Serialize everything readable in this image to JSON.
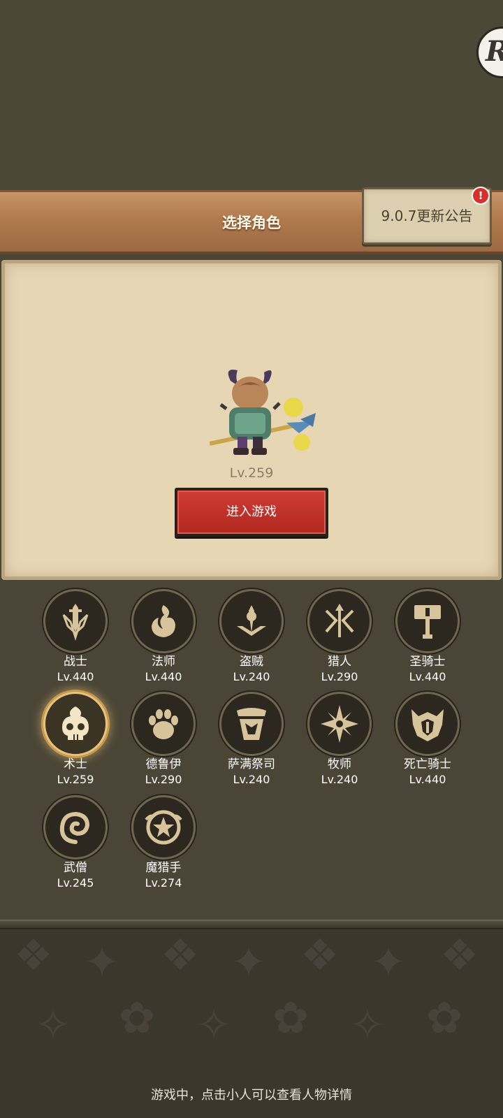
{
  "header": {
    "title": "选择角色",
    "notice_label": "9.0.7更新公告",
    "notice_badge": "!"
  },
  "corner_button_glyph": "R",
  "character": {
    "level": "Lv.259"
  },
  "enter_button_label": "进入游戏",
  "classes": [
    {
      "name": "战士",
      "level": "Lv.440",
      "icon": "sword-icon"
    },
    {
      "name": "法师",
      "level": "Lv.440",
      "icon": "flame-icon"
    },
    {
      "name": "盗贼",
      "level": "Lv.240",
      "icon": "dagger-icon"
    },
    {
      "name": "猎人",
      "level": "Lv.290",
      "icon": "arrows-icon"
    },
    {
      "name": "圣骑士",
      "level": "Lv.440",
      "icon": "hammer-icon"
    },
    {
      "name": "术士",
      "level": "Lv.259",
      "icon": "skull-icon",
      "selected": true
    },
    {
      "name": "德鲁伊",
      "level": "Lv.290",
      "icon": "paw-icon"
    },
    {
      "name": "萨满祭司",
      "level": "Lv.240",
      "icon": "totem-icon"
    },
    {
      "name": "牧师",
      "level": "Lv.240",
      "icon": "star-icon"
    },
    {
      "name": "死亡骑士",
      "level": "Lv.440",
      "icon": "helmet-icon"
    },
    {
      "name": "武僧",
      "level": "Lv.245",
      "icon": "spiral-icon"
    },
    {
      "name": "魔猎手",
      "level": "Lv.274",
      "icon": "demon-star-icon"
    }
  ],
  "footer_hint": "游戏中，点击小人可以查看人物详情",
  "colors": {
    "accent_gold": "#e6c47d",
    "button_red": "#c3332b",
    "wood": "#b17a4e",
    "parchment": "#e7d6b4"
  }
}
